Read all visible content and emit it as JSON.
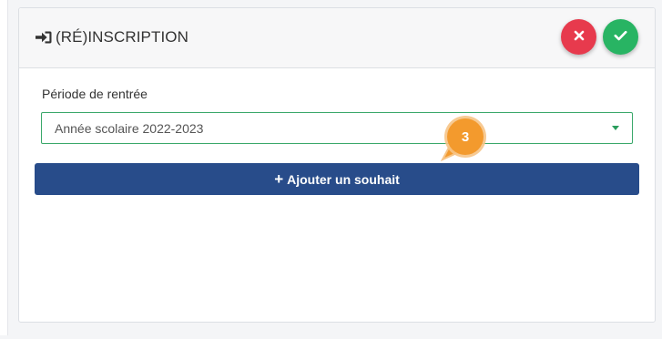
{
  "panel": {
    "title": "(RÉ)INSCRIPTION",
    "title_icon": "sign-in-icon",
    "cancel_icon": "close-icon",
    "confirm_icon": "check-icon"
  },
  "form": {
    "period_label": "Période de rentrée",
    "period_value": "Année scolaire 2022-2023"
  },
  "actions": {
    "add_wish_label": "Ajouter un souhait"
  },
  "annotation": {
    "step": "3"
  },
  "colors": {
    "cancel": "#e73a4d",
    "confirm": "#28b463",
    "primary": "#284c8a",
    "select_border": "#3aa86a",
    "badge": "#f39a2d"
  }
}
